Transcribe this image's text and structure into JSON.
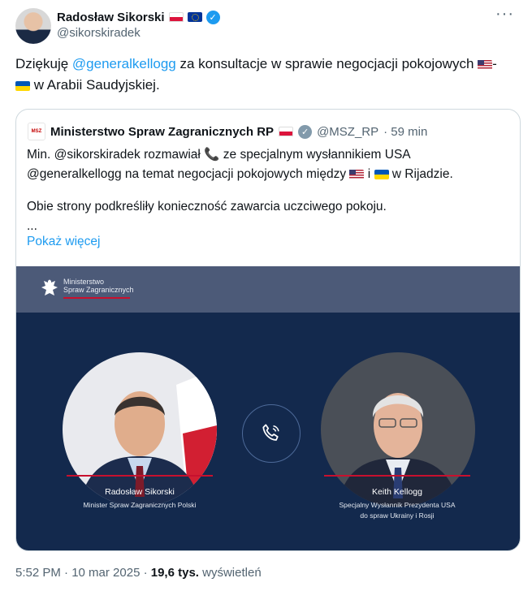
{
  "author": {
    "name": "Radosław Sikorski",
    "handle": "@sikorskiradek"
  },
  "tweet": {
    "text_before": "Dziękuję ",
    "mention": "@generalkellogg",
    "text_after": " za konsultacje w sprawie negocjacji pokojowych ",
    "flag_separator": "-",
    "text_end": " w Arabii Saudyjskiej."
  },
  "quote": {
    "logo_text": "MSZ",
    "name": "Ministerstwo Spraw Zagranicznych RP",
    "handle": "@MSZ_RP",
    "time": "· 59 min",
    "line1_before": "Min. @sikorskiradek rozmawiał ",
    "line1_after": " ze specjalnym wysłannikiem USA",
    "line2_before": "@generalkellogg na temat negocjacji pokojowych między ",
    "line2_mid": " i ",
    "line2_after": " w Rijadzie.",
    "line3": "Obie strony podkreśliły konieczność zawarcia uczciwego pokoju.",
    "ellipsis": "...",
    "show_more": "Pokaż więcej"
  },
  "graphic": {
    "ministry_line1": "Ministerstwo",
    "ministry_line2": "Spraw Zagranicznych",
    "left_name": "Radosław Sikorski",
    "left_role": "Minister Spraw Zagranicznych Polski",
    "right_name": "Keith Kellogg",
    "right_role1": "Specjalny Wysłannik Prezydenta USA",
    "right_role2": "do spraw Ukrainy i Rosji"
  },
  "footer": {
    "time": "5:52 PM · 10 mar 2025 · ",
    "views": "19,6 tys.",
    "views_label": " wyświetleń"
  },
  "icons": [
    "more-icon",
    "verified-icon",
    "phone-icon",
    "eagle-icon",
    "flag-pl-icon",
    "flag-eu-icon",
    "flag-us-icon",
    "flag-ua-icon"
  ],
  "colors": {
    "link": "#1d9bf0",
    "verified": "#1d9bf0",
    "media_bg": "#13294d",
    "accent_red": "#c8102e"
  }
}
